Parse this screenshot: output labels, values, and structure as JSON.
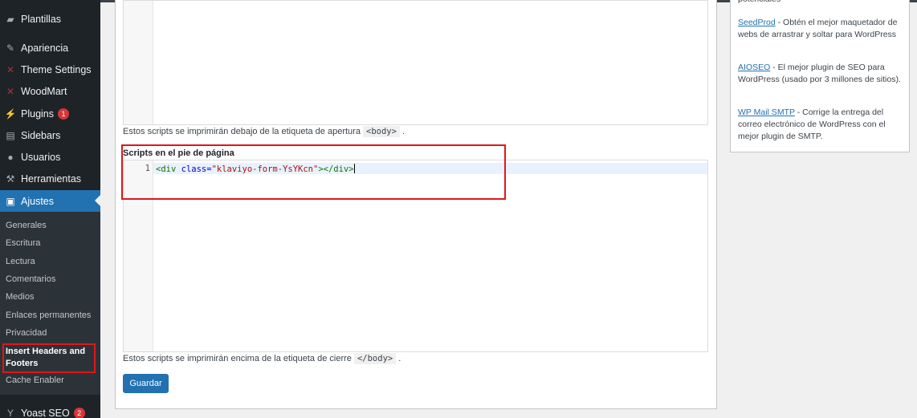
{
  "sidebar": {
    "items": [
      {
        "label": "Plantillas",
        "icon": "folder-icon"
      },
      {
        "label": "Apariencia",
        "icon": "brush-icon"
      },
      {
        "label": "Theme Settings",
        "icon": "woodmart-icon"
      },
      {
        "label": "WoodMart",
        "icon": "woodmart-icon"
      },
      {
        "label": "Plugins",
        "icon": "plugin-icon",
        "badge": "1"
      },
      {
        "label": "Sidebars",
        "icon": "sidebars-icon"
      },
      {
        "label": "Usuarios",
        "icon": "user-icon"
      },
      {
        "label": "Herramientas",
        "icon": "wrench-icon"
      },
      {
        "label": "Ajustes",
        "icon": "settings-icon"
      }
    ],
    "submenu": [
      "Generales",
      "Escritura",
      "Lectura",
      "Comentarios",
      "Medios",
      "Enlaces permanentes",
      "Privacidad",
      "Insert Headers and Footers",
      "Cache Enabler"
    ],
    "bottom_item": {
      "label": "Yoast SEO",
      "badge": "2"
    }
  },
  "main": {
    "body_desc_prefix": "Estos scripts se imprimirán debajo de la etiqueta de apertura",
    "body_tag": "<body>",
    "body_desc_suffix": ".",
    "footer_label": "Scripts en el pie de página",
    "line_number": "1",
    "code": {
      "open": "<div",
      "attr": "class=",
      "value": "\"klaviyo-form-YsYKcn\"",
      "close": "></div>"
    },
    "footer_desc_prefix": "Estos scripts se imprimirán encima de la etiqueta de cierre",
    "footer_tag": "</body>",
    "footer_desc_suffix": ".",
    "save_label": "Guardar"
  },
  "widget": {
    "top_fragment": "potenciales",
    "links": [
      {
        "name": "SeedProd",
        "text": " - Obtén el mejor maquetador de webs de arrastrar y soltar para WordPress"
      },
      {
        "name": "AIOSEO",
        "text": " - El mejor plugin de SEO para WordPress (usado por 3 millones de sitios)."
      },
      {
        "name": "WP Mail SMTP",
        "text": " - Corrige la entrega del correo electrónico de WordPress con el mejor plugin de SMTP."
      }
    ]
  },
  "colors": {
    "sidebar_bg": "#1d2327",
    "accent": "#2271b1",
    "highlight_box": "#e0161b",
    "badge": "#d63638"
  }
}
